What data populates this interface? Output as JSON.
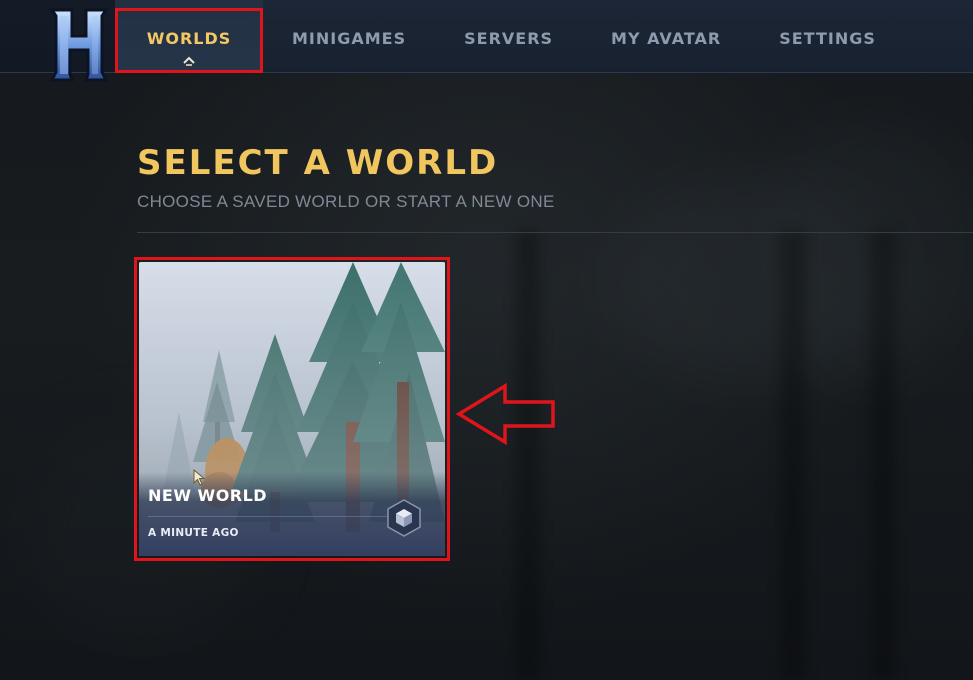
{
  "nav": {
    "logo": "game-logo",
    "items": [
      {
        "label": "WORLDS",
        "active": true
      },
      {
        "label": "MINIGAMES",
        "active": false
      },
      {
        "label": "SERVERS",
        "active": false
      },
      {
        "label": "MY AVATAR",
        "active": false
      },
      {
        "label": "SETTINGS",
        "active": false
      }
    ]
  },
  "header": {
    "title": "SELECT A WORLD",
    "subtitle": "CHOOSE A SAVED WORLD OR START A NEW ONE"
  },
  "worlds": [
    {
      "name": "NEW WORLD",
      "last_played": "A MINUTE AGO",
      "icon": "cube-icon"
    }
  ],
  "colors": {
    "accent": "#f2c65f",
    "nav_inactive": "#8e9aad",
    "annotation": "#e0151b",
    "topbar": "#1c2636"
  }
}
